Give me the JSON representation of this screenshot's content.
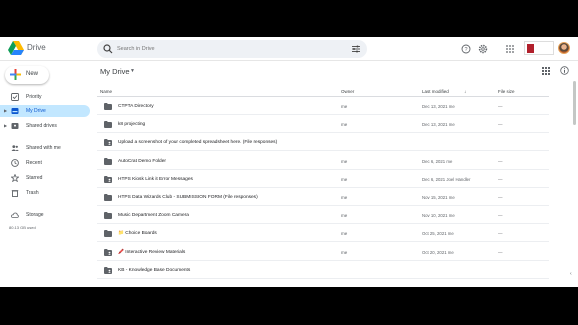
{
  "app": {
    "title": "Drive"
  },
  "search": {
    "placeholder": "Search in Drive"
  },
  "sidebar": {
    "new_label": "New",
    "items": [
      {
        "label": "Priority"
      },
      {
        "label": "My Drive"
      },
      {
        "label": "Shared drives"
      },
      {
        "label": "Shared with me"
      },
      {
        "label": "Recent"
      },
      {
        "label": "Starred"
      },
      {
        "label": "Trash"
      },
      {
        "label": "Storage"
      }
    ],
    "storage_used": "80.13 GB used"
  },
  "main": {
    "title": "My Drive",
    "columns": {
      "name": "Name",
      "owner": "Owner",
      "modified": "Last modified",
      "size": "File size"
    },
    "rows": [
      {
        "name": "CTPTA Directory",
        "owner": "me",
        "modified": "Dec 13, 2021 me",
        "size": "—",
        "icon": "folder-icon"
      },
      {
        "name": "k8 projecting",
        "owner": "me",
        "modified": "Dec 13, 2021 me",
        "size": "—",
        "icon": "folder-icon"
      },
      {
        "name": "Upload a screenshot of your completed spreadsheet here. (File responses)",
        "owner": "",
        "modified": "",
        "size": "",
        "icon": "shared-folder-icon"
      },
      {
        "name": "AutoCrat Demo Folder",
        "owner": "me",
        "modified": "Dec 6, 2021 me",
        "size": "—",
        "icon": "folder-icon"
      },
      {
        "name": "HTPS Kiosk Link it Error Messages",
        "owner": "me",
        "modified": "Dec 6, 2021 Joel Handler",
        "size": "—",
        "icon": "shared-folder-icon"
      },
      {
        "name": "HTPS Data Wizards Club - SUBMISSION FORM (File responses)",
        "owner": "me",
        "modified": "Nov 15, 2021 me",
        "size": "—",
        "icon": "folder-icon"
      },
      {
        "name": "Music Department Zoom Camera",
        "owner": "me",
        "modified": "Nov 10, 2021 me",
        "size": "—",
        "icon": "folder-icon"
      },
      {
        "name": "📁 Choice Boards",
        "owner": "me",
        "modified": "Oct 25, 2021 me",
        "size": "—",
        "icon": "folder-icon"
      },
      {
        "name": "🖍️ Interactive Review Materials",
        "owner": "me",
        "modified": "Oct 20, 2021 me",
        "size": "—",
        "icon": "shared-folder-icon"
      },
      {
        "name": "KB - Knowledge Base Documents",
        "owner": "",
        "modified": "",
        "size": "",
        "icon": "shared-folder-icon"
      }
    ]
  },
  "colors": {
    "accent": "#0b57d0",
    "active_bg": "#c2e7ff",
    "folder": "#5f6368"
  }
}
